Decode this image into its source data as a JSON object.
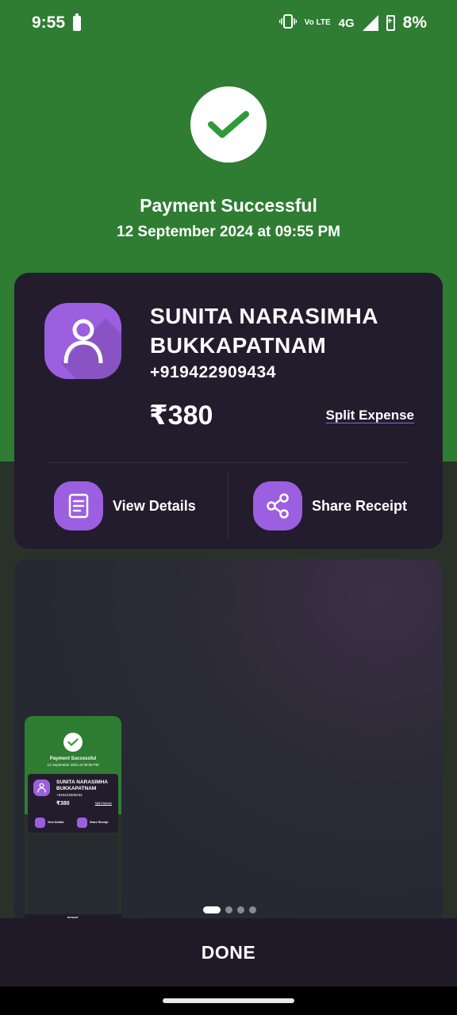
{
  "status_bar": {
    "time": "9:55",
    "network": "4G",
    "lte_label": "Vo LTE",
    "battery": "8%"
  },
  "success": {
    "title": "Payment Successful",
    "datetime": "12 September 2024 at 09:55 PM"
  },
  "recipient": {
    "name": "SUNITA NARASIMHA BUKKAPATNAM",
    "phone": "+919422909434",
    "amount": "₹380",
    "split_label": "Split Expense"
  },
  "actions": {
    "view_details": "View Details",
    "share_receipt": "Share Receipt"
  },
  "thumbnail": {
    "title": "Payment Successful",
    "datetime": "12 September 2024 at 09:55 PM",
    "name": "SUNITA NARASIMHA BUKKAPATNAM",
    "phone": "+919422909434",
    "amount": "₹380",
    "split_label": "Split Expense",
    "view_details": "View Details",
    "share_receipt": "Share Receipt",
    "done": "DONE"
  },
  "pager": {
    "pages": 4,
    "active": 1
  },
  "done_label": "DONE",
  "colors": {
    "success_green": "#2e7d32",
    "card_bg": "#231c2d",
    "accent_purple": "#9c5fe0"
  }
}
